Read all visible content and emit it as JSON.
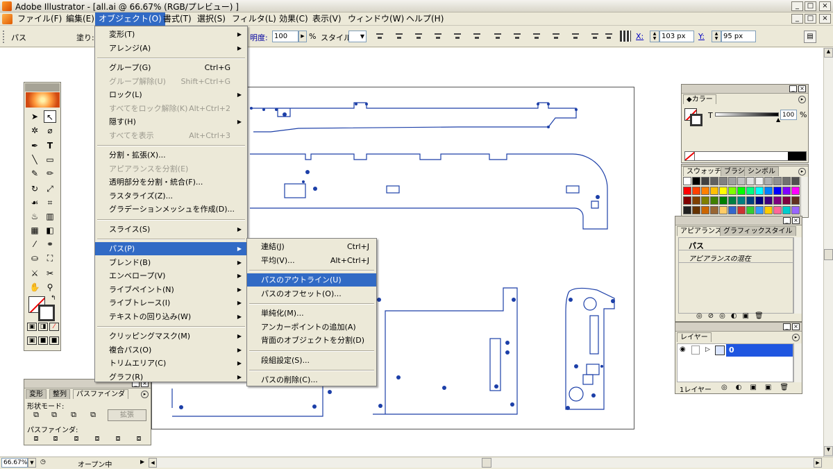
{
  "window": {
    "title": "Adobe Illustrator - [all.ai @ 66.67% (RGB/プレビュー) ]",
    "controls": [
      "_",
      "□",
      "×"
    ]
  },
  "menubar": {
    "items": [
      "ファイル(F)",
      "編集(E)",
      "オブジェクト(O)",
      "書式(T)",
      "選択(S)",
      "フィルタ(L)",
      "効果(C)",
      "表示(V)",
      "ウィンドウ(W)",
      "ヘルプ(H)"
    ],
    "active_index": 2
  },
  "controlbar": {
    "path_label": "パス",
    "fill_label": "塗り:",
    "opacity_label": "明度:",
    "opacity_value": "100",
    "percent": "%",
    "style_label": "スタイル:",
    "x_label": "X:",
    "x_value": "103 px",
    "y_label": "Y:",
    "y_value": "95 px"
  },
  "object_menu": {
    "items": [
      {
        "label": "変形(T)",
        "shortcut": "",
        "submenu": true,
        "disabled": false
      },
      {
        "label": "アレンジ(A)",
        "shortcut": "",
        "submenu": true,
        "disabled": false
      },
      {
        "sep": true
      },
      {
        "label": "グループ(G)",
        "shortcut": "Ctrl+G",
        "submenu": false,
        "disabled": false
      },
      {
        "label": "グループ解除(U)",
        "shortcut": "Shift+Ctrl+G",
        "submenu": false,
        "disabled": true
      },
      {
        "label": "ロック(L)",
        "shortcut": "",
        "submenu": true,
        "disabled": false
      },
      {
        "label": "すべてをロック解除(K)",
        "shortcut": "Alt+Ctrl+2",
        "submenu": false,
        "disabled": true
      },
      {
        "label": "隠す(H)",
        "shortcut": "",
        "submenu": true,
        "disabled": false
      },
      {
        "label": "すべてを表示",
        "shortcut": "Alt+Ctrl+3",
        "submenu": false,
        "disabled": true
      },
      {
        "sep": true
      },
      {
        "label": "分割・拡張(X)...",
        "shortcut": "",
        "submenu": false,
        "disabled": false
      },
      {
        "label": "アピアランスを分割(E)",
        "shortcut": "",
        "submenu": false,
        "disabled": true
      },
      {
        "label": "透明部分を分割・統合(F)...",
        "shortcut": "",
        "submenu": false,
        "disabled": false
      },
      {
        "label": "ラスタライズ(Z)...",
        "shortcut": "",
        "submenu": false,
        "disabled": false
      },
      {
        "label": "グラデーションメッシュを作成(D)...",
        "shortcut": "",
        "submenu": false,
        "disabled": false
      },
      {
        "sep": true
      },
      {
        "label": "スライス(S)",
        "shortcut": "",
        "submenu": true,
        "disabled": false
      },
      {
        "sep": true
      },
      {
        "label": "パス(P)",
        "shortcut": "",
        "submenu": true,
        "disabled": false,
        "highlight": true
      },
      {
        "label": "ブレンド(B)",
        "shortcut": "",
        "submenu": true,
        "disabled": false
      },
      {
        "label": "エンベロープ(V)",
        "shortcut": "",
        "submenu": true,
        "disabled": false
      },
      {
        "label": "ライブペイント(N)",
        "shortcut": "",
        "submenu": true,
        "disabled": false
      },
      {
        "label": "ライブトレース(I)",
        "shortcut": "",
        "submenu": true,
        "disabled": false
      },
      {
        "label": "テキストの回り込み(W)",
        "shortcut": "",
        "submenu": true,
        "disabled": false
      },
      {
        "sep": true
      },
      {
        "label": "クリッピングマスク(M)",
        "shortcut": "",
        "submenu": true,
        "disabled": false
      },
      {
        "label": "複合パス(O)",
        "shortcut": "",
        "submenu": true,
        "disabled": false
      },
      {
        "label": "トリムエリア(C)",
        "shortcut": "",
        "submenu": true,
        "disabled": false
      },
      {
        "label": "グラフ(R)",
        "shortcut": "",
        "submenu": true,
        "disabled": false
      }
    ]
  },
  "path_submenu": {
    "items": [
      {
        "label": "連結(J)",
        "shortcut": "Ctrl+J"
      },
      {
        "label": "平均(V)...",
        "shortcut": "Alt+Ctrl+J"
      },
      {
        "sep": true
      },
      {
        "label": "パスのアウトライン(U)",
        "shortcut": "",
        "highlight": true
      },
      {
        "label": "パスのオフセット(O)...",
        "shortcut": ""
      },
      {
        "sep": true
      },
      {
        "label": "単純化(M)...",
        "shortcut": ""
      },
      {
        "label": "アンカーポイントの追加(A)",
        "shortcut": ""
      },
      {
        "label": "背面のオブジェクトを分割(D)",
        "shortcut": ""
      },
      {
        "sep": true
      },
      {
        "label": "段組設定(S)...",
        "shortcut": ""
      },
      {
        "sep": true
      },
      {
        "label": "パスの削除(C)...",
        "shortcut": ""
      }
    ]
  },
  "color_panel": {
    "tab": "カラー",
    "t_label": "T",
    "value": "100",
    "percent": "%"
  },
  "swatch_panel": {
    "tabs": [
      "スウォッチ",
      "ブラシ",
      "シンボル"
    ]
  },
  "appearance_panel": {
    "tabs": [
      "アピアランス",
      "グラフィックスタイル"
    ],
    "title": "パス",
    "row": "アピアランスの混在"
  },
  "layers_panel": {
    "tab": "レイヤー",
    "layer_name": "0",
    "footer": "1レイヤー"
  },
  "pathfinder_panel": {
    "tabs": [
      "変形",
      "整列",
      "パスファインダ"
    ],
    "shape_mode_label": "形状モード:",
    "expand_button": "拡張",
    "pathfinder_label": "パスファインダ:"
  },
  "statusbar": {
    "zoom": "66.67%",
    "status": "オープン中"
  },
  "colors": {
    "accent": "#316ac5",
    "path": "#1c3fa8",
    "chrome": "#ece9d8"
  }
}
